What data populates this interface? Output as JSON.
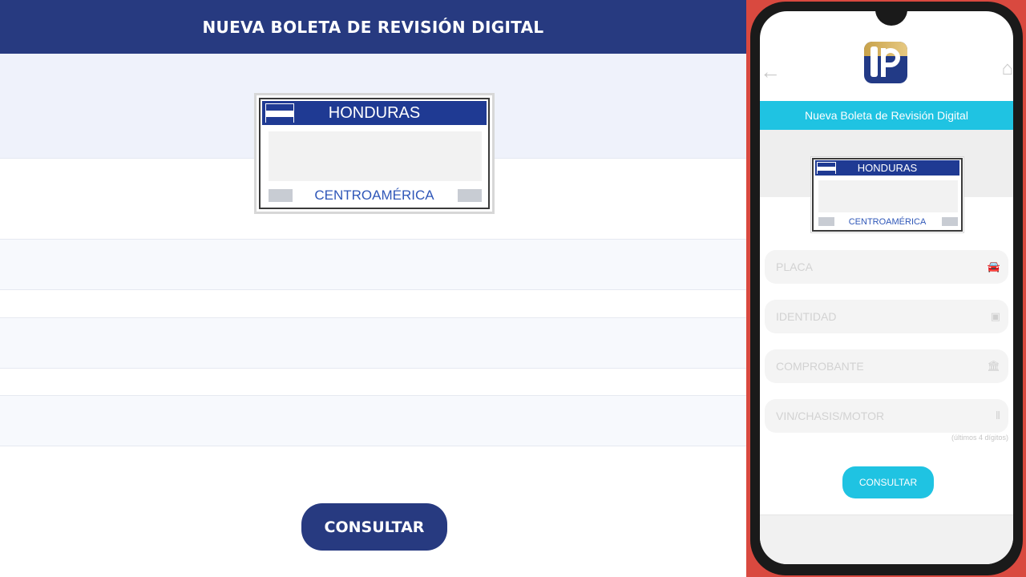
{
  "web": {
    "title": "NUEVA BOLETA DE REVISIÓN DIGITAL",
    "plate": {
      "country": "HONDURAS",
      "region": "CENTROAMÉRICA"
    },
    "consult_label": "CONSULTAR"
  },
  "mobile": {
    "title": "Nueva Boleta de Revisión Digital",
    "plate": {
      "country": "HONDURAS",
      "region": "CENTROAMÉRICA"
    },
    "fields": [
      {
        "placeholder": "PLACA",
        "icon": "car-icon"
      },
      {
        "placeholder": "IDENTIDAD",
        "icon": "id-card-icon"
      },
      {
        "placeholder": "COMPROBANTE",
        "icon": "bank-icon"
      },
      {
        "placeholder": "VIN/CHASIS/MOTOR",
        "icon": "barcode-icon"
      }
    ],
    "hint": "(últimos 4 dígitos)",
    "consult_label": "CONSULTAR"
  },
  "colors": {
    "web_primary": "#273a80",
    "mobile_accent": "#1fc3e2",
    "plate_blue": "#1f3a93",
    "background_red": "#d9493f"
  }
}
